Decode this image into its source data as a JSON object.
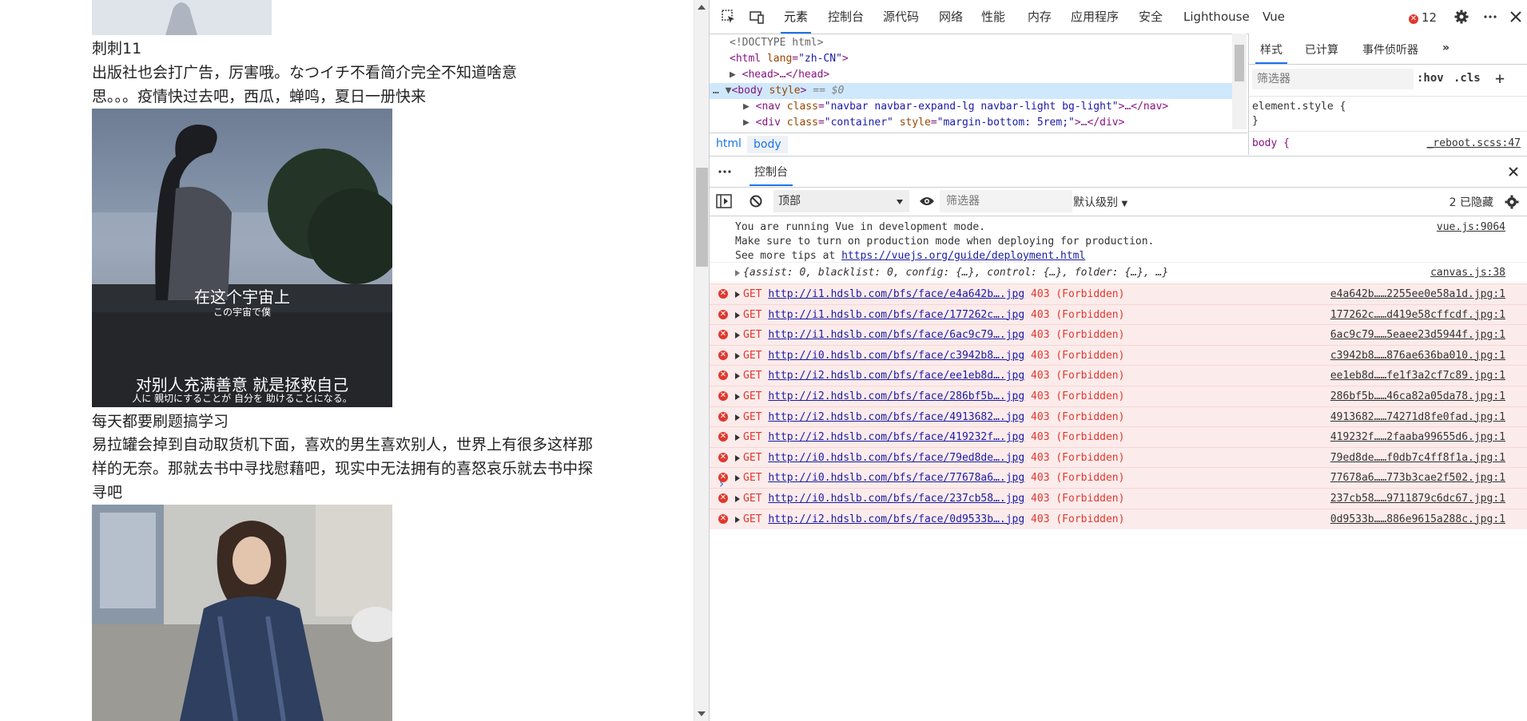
{
  "page": {
    "post1_title": "刺刺11",
    "post1_text": "出版社也会打广告，厉害哦。なつイチ不看简介完全不知道啥意思。。。疫情快过去吧，西瓜，蝉鸣，夏日一册快来",
    "post1_caption_zh_1": "在这个宇宙上",
    "post1_caption_jp_1": "この宇宙で僕",
    "post1_caption_zh_2": "对别人充满善意 就是拯救自己",
    "post1_caption_jp_2": "人に 親切にすることが 自分を 助けることになる。",
    "post2_title": "每天都要刷题搞学习",
    "post2_text": "易拉罐会掉到自动取货机下面，喜欢的男生喜欢别人，世界上有很多这样那样的无奈。那就去书中寻找慰藉吧，现实中无法拥有的喜怒哀乐就去书中探寻吧"
  },
  "devtools": {
    "tabs": [
      "元素",
      "控制台",
      "源代码",
      "网络",
      "性能",
      "内存",
      "应用程序",
      "安全",
      "Lighthouse",
      "Vue"
    ],
    "active_tab": "元素",
    "error_count": "12",
    "elements": {
      "doctype": "<!DOCTYPE html>",
      "html_open": "<html",
      "html_lang_attr": "lang",
      "html_lang_val": "\"zh-CN\"",
      "head": "<head>…</head>",
      "body_tag": "<body",
      "body_attr": "style",
      "body_dollar": "== $0",
      "nav_tag": "<nav",
      "nav_class_attr": "class",
      "nav_class_val": "\"navbar navbar-expand-lg navbar-light bg-light\"",
      "nav_close": ">…</nav>",
      "div_tag": "<div",
      "div_class_attr": "class",
      "div_class_val": "\"container\"",
      "div_style_attr": "style",
      "div_style_val": "\"margin-bottom: 5rem;\"",
      "div_close": ">…</div>",
      "ellipsis": "…"
    },
    "breadcrumbs": [
      "html",
      "body"
    ],
    "styles": {
      "tabs": [
        "样式",
        "已计算",
        "事件侦听器"
      ],
      "filter_placeholder": "筛选器",
      "hov": ":hov",
      "cls": ".cls",
      "rule1": "element.style {",
      "rule1_close": "}",
      "rule2": "body {",
      "rule2_src": "_reboot.scss:47"
    },
    "drawer": {
      "tab": "控制台",
      "context": "顶部",
      "filter_placeholder": "筛选器",
      "level": "默认级别",
      "hidden": "2 已隐藏"
    },
    "console": {
      "vue_msg_1": "You are running Vue in development mode.",
      "vue_msg_2": "Make sure to turn on production mode when deploying for production.",
      "vue_msg_3": "See more tips at ",
      "vue_msg_3_link": "https://vuejs.org/guide/deployment.html",
      "vue_src": "vue.js:9064",
      "obj_msg": "{assist: 0, blacklist: 0, config: {…}, control: {…}, folder: {…}, …}",
      "obj_src": "canvas.js:38",
      "errors": [
        {
          "method": "GET",
          "url": "http://i1.hdslb.com/bfs/face/e4a642b….jpg",
          "status": "403 (Forbidden)",
          "src": "e4a642b……2255ee0e58a1d.jpg:1"
        },
        {
          "method": "GET",
          "url": "http://i1.hdslb.com/bfs/face/177262c….jpg",
          "status": "403 (Forbidden)",
          "src": "177262c……d419e58cffcdf.jpg:1"
        },
        {
          "method": "GET",
          "url": "http://i1.hdslb.com/bfs/face/6ac9c79….jpg",
          "status": "403 (Forbidden)",
          "src": "6ac9c79……5eaee23d5944f.jpg:1"
        },
        {
          "method": "GET",
          "url": "http://i0.hdslb.com/bfs/face/c3942b8….jpg",
          "status": "403 (Forbidden)",
          "src": "c3942b8……876ae636ba010.jpg:1"
        },
        {
          "method": "GET",
          "url": "http://i2.hdslb.com/bfs/face/ee1eb8d….jpg",
          "status": "403 (Forbidden)",
          "src": "ee1eb8d……fe1f3a2cf7c89.jpg:1"
        },
        {
          "method": "GET",
          "url": "http://i2.hdslb.com/bfs/face/286bf5b….jpg",
          "status": "403 (Forbidden)",
          "src": "286bf5b……46ca82a05da78.jpg:1"
        },
        {
          "method": "GET",
          "url": "http://i2.hdslb.com/bfs/face/4913682….jpg",
          "status": "403 (Forbidden)",
          "src": "4913682……74271d8fe0fad.jpg:1"
        },
        {
          "method": "GET",
          "url": "http://i2.hdslb.com/bfs/face/419232f….jpg",
          "status": "403 (Forbidden)",
          "src": "419232f……2faaba99655d6.jpg:1"
        },
        {
          "method": "GET",
          "url": "http://i0.hdslb.com/bfs/face/79ed8de….jpg",
          "status": "403 (Forbidden)",
          "src": "79ed8de……f0db7c4ff8f1a.jpg:1"
        },
        {
          "method": "GET",
          "url": "http://i0.hdslb.com/bfs/face/77678a6….jpg",
          "status": "403 (Forbidden)",
          "src": "77678a6……773b3cae2f502.jpg:1"
        },
        {
          "method": "GET",
          "url": "http://i0.hdslb.com/bfs/face/237cb58….jpg",
          "status": "403 (Forbidden)",
          "src": "237cb58……9711879c6dc67.jpg:1"
        },
        {
          "method": "GET",
          "url": "http://i2.hdslb.com/bfs/face/0d9533b….jpg",
          "status": "403 (Forbidden)",
          "src": "0d9533b……886e9615a288c.jpg:1"
        }
      ],
      "prompt": "›"
    }
  },
  "colors": {
    "accent": "#1a73e8",
    "error": "#e0382d",
    "error_bg": "#fcebeb"
  }
}
